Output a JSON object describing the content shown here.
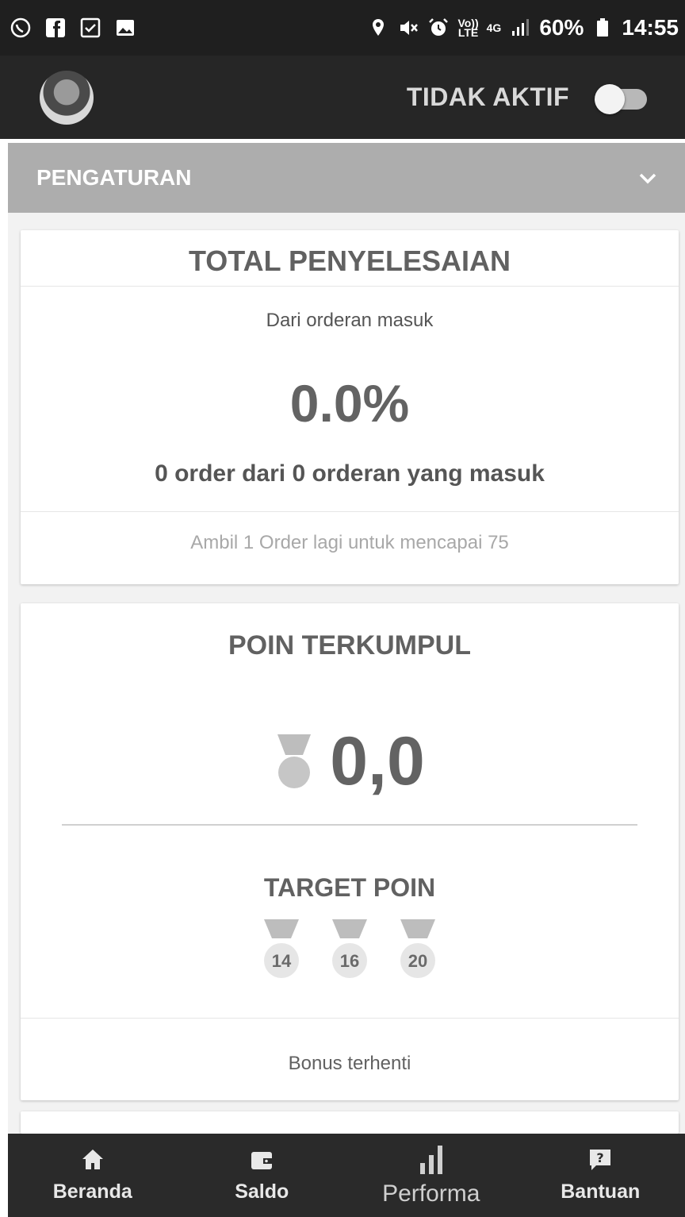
{
  "status_bar": {
    "left_icons": [
      "whatsapp-icon",
      "facebook-icon",
      "checkbox-icon",
      "gallery-icon"
    ],
    "volte_line1": "Vo))",
    "volte_line2": "LTE",
    "network": "4G",
    "battery_percent": "60%",
    "time": "14:55"
  },
  "header": {
    "status_label": "TIDAK AKTIF",
    "toggle_on": false
  },
  "settings": {
    "title": "PENGATURAN"
  },
  "completion_card": {
    "title": "TOTAL PENYELESAIAN",
    "subtitle": "Dari orderan masuk",
    "percent": "0.0%",
    "summary": "0 order dari 0 orderan yang masuk",
    "footer": "Ambil 1 Order lagi untuk mencapai 75"
  },
  "points_card": {
    "title": "POIN TERKUMPUL",
    "points": "0,0",
    "target_title": "TARGET POIN",
    "targets": [
      "14",
      "16",
      "20"
    ],
    "bonus_text": "Bonus terhenti"
  },
  "bottom_nav": {
    "items": [
      {
        "label": "Beranda",
        "icon": "home-icon"
      },
      {
        "label": "Saldo",
        "icon": "wallet-icon"
      },
      {
        "label": "Performa",
        "icon": "bar-chart-icon"
      },
      {
        "label": "Bantuan",
        "icon": "help-icon"
      }
    ]
  },
  "colors": {
    "status_bar_bg": "#1f1f1f",
    "header_bg": "#262626",
    "settings_bar_bg": "#adadad",
    "content_bg": "#f2f2f2",
    "nav_bg": "#2a2a2a"
  }
}
